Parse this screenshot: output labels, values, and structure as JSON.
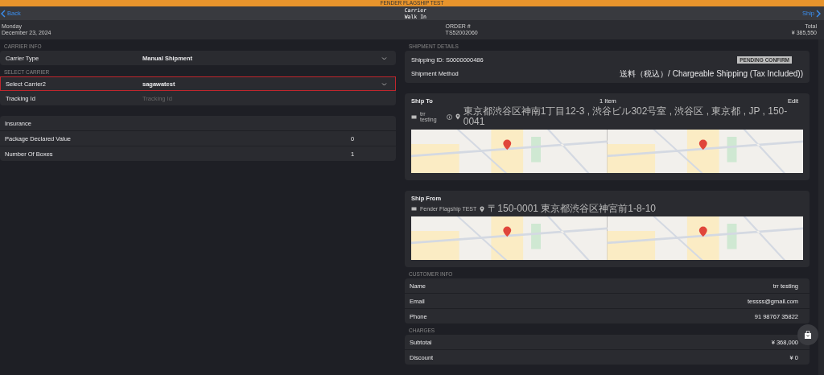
{
  "top_banner": {
    "text": "FENDER FLAGSHIP TEST"
  },
  "header": {
    "back": "Back",
    "title": "Carrier",
    "subtitle": "Walk In",
    "ship": "Ship"
  },
  "summary": {
    "day": "Monday",
    "date": "December 23, 2024",
    "order_label": "ORDER #",
    "order": "TS52002060",
    "total_label": "Total",
    "total": "¥ 385,550"
  },
  "carrier_info": {
    "heading": "CARRIER INFO",
    "rows": [
      {
        "kind": "select",
        "label": "Carrier Type",
        "value": "Manual Shipment",
        "selected": false
      }
    ]
  },
  "select_carrier": {
    "heading": "SELECT CARRIER",
    "rows": [
      {
        "kind": "select",
        "label": "Select Carrier2",
        "value": "sagawatest",
        "selected": true
      },
      {
        "kind": "input",
        "label": "Tracking Id",
        "placeholder": "Tracking Id",
        "selected": false
      }
    ]
  },
  "insurance": {
    "rows": [
      {
        "label": "Insurance"
      },
      {
        "label": "Package Declared Value",
        "value": "0"
      },
      {
        "label": "Number Of Boxes",
        "value": "1"
      }
    ]
  },
  "shipment_details": {
    "heading": "SHIPMENT DETAILS",
    "shipping_id": "Shipping ID: S0000000486",
    "status": "PENDING CONFIRM",
    "method_label": "Shipment Method",
    "method": "送料（税込）/ Chargeable Shipping (Tax Included))"
  },
  "ship_to": {
    "title": "Ship To",
    "items": "1 Item",
    "edit": "Edit",
    "name": "trr testing",
    "address": "東京都渋谷区神南1丁目12-3 , 渋谷ビル302号室 , 渋谷区 , 東京都 , JP , 150-0041"
  },
  "ship_from": {
    "title": "Ship From",
    "name": "Fender Flagship TEST",
    "address": "〒150-0001 東京都渋谷区神宮前1-8-10"
  },
  "customer_info": {
    "heading": "CUSTOMER INFO",
    "rows": [
      {
        "label": "Name",
        "value": "trr testing"
      },
      {
        "label": "Email",
        "value": "tessss@gmail.com"
      },
      {
        "label": "Phone",
        "value": "91 98767 35822"
      }
    ]
  },
  "charges": {
    "heading": "CHARGES",
    "rows": [
      {
        "label": "Subtotal",
        "value": "¥ 368,000"
      },
      {
        "label": "Discount",
        "value": "¥ 0"
      }
    ]
  }
}
